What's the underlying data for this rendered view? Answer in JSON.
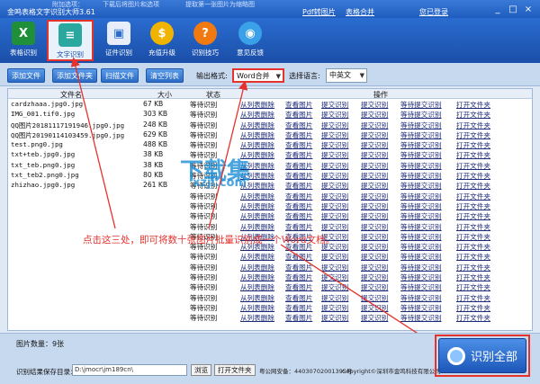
{
  "window": {
    "title": "金鸣表格文字识别大师3.61",
    "top_links": [
      "Pdf转图片",
      "表格合并",
      "您已登录"
    ],
    "controls": [
      "_",
      "□",
      "×"
    ],
    "top_checks": [
      "附加选项：",
      "下载后将图片和选项",
      "提取第一张图片为缩略图"
    ]
  },
  "ribbon": {
    "items": [
      {
        "label": "表格识别",
        "icon": "excel-icon",
        "glyph": "X",
        "color": "#1f8f3a"
      },
      {
        "label": "文字识别",
        "icon": "document-icon",
        "glyph": "≡",
        "color": "#2aa8a0"
      },
      {
        "label": "证件识别",
        "icon": "id-card-icon",
        "glyph": "▣",
        "color": "#e8eef9"
      },
      {
        "label": "充值升级",
        "icon": "coin-icon",
        "glyph": "$",
        "color": "#f0b400"
      },
      {
        "label": "识别技巧",
        "icon": "question-icon",
        "glyph": "?",
        "color": "#f07a10"
      },
      {
        "label": "意见反馈",
        "icon": "feedback-icon",
        "glyph": "◉",
        "color": "#3aa0e8"
      }
    ]
  },
  "toolbar": {
    "buttons": [
      "添加文件",
      "添加文件夹",
      "扫描文件",
      "清空列表"
    ],
    "output_format_label": "输出格式:",
    "output_format_value": "Word合并",
    "language_label": "选择语言:",
    "language_value": "中英文"
  },
  "grid": {
    "headers": {
      "name": "文件名",
      "size": "大小",
      "status": "状态",
      "ops": "操作"
    },
    "ops": [
      "从列表删除",
      "查看图片",
      "提交识别",
      "提交识别",
      "等待提交识别",
      "打开文件夹"
    ],
    "rows": [
      {
        "name": "cardzhaaa.jpg0.jpg",
        "size": "67 KB",
        "status": "等待识别"
      },
      {
        "name": "IMG_001.tif0.jpg",
        "size": "303 KB",
        "status": "等待识别"
      },
      {
        "name": "QQ图片20181117191946.jpg0.jpg",
        "size": "248 KB",
        "status": "等待识别"
      },
      {
        "name": "QQ图片20190114103459.jpg0.jpg",
        "size": "629 KB",
        "status": "等待识别"
      },
      {
        "name": "test.png0.jpg",
        "size": "488 KB",
        "status": "等待识别"
      },
      {
        "name": "txt+teb.jpg0.jpg",
        "size": "38 KB",
        "status": "等待识别"
      },
      {
        "name": "txt_teb.png0.jpg",
        "size": "38 KB",
        "status": "等待识别"
      },
      {
        "name": "txt_teb2.png0.jpg",
        "size": "80 KB",
        "status": "等待识别"
      },
      {
        "name": "zhizhao.jpg0.jpg",
        "size": "261 KB",
        "status": "等待识别"
      }
    ],
    "empty_status": "等待识别",
    "empty_rows": 13
  },
  "watermark": {
    "line1": "下载集",
    "line2": "xzji.com"
  },
  "annotation": "点击这三处，即可将数十张图片批量识别成一个Word文档。",
  "status": {
    "count": "图片数量：9张",
    "save_label": "识别结果保存目录：",
    "save_path": "D:\\jmocr\\jm189cn\\",
    "browse_button": "浏览",
    "open_folder_button": "打开文件夹",
    "record": "粤公网安备：44030702001395号",
    "copyright": "Copyright©深圳市金鸣科技有限公司"
  },
  "recognize_all": "识别全部",
  "colors": {
    "accent": "#1f5cbf",
    "highlight": "#e5322d"
  }
}
